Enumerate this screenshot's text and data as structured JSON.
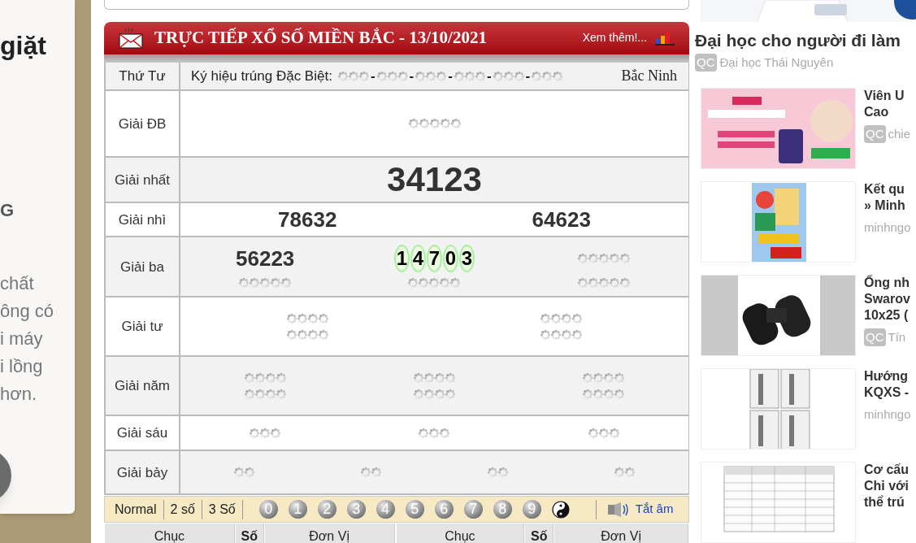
{
  "left_card": {
    "heading": "giặt",
    "subheading": "G",
    "paragraph_lines": [
      "chất",
      "ông có",
      "i máy",
      "i lồng",
      "hơn."
    ]
  },
  "results": {
    "title": "TRỰC TIẾP XỔ SỐ MIỀN BẮC - 13/10/2021",
    "more_link": "Xem thêm!...",
    "day": "Thứ Tư",
    "code_label": "Ký hiệu trúng Đặc Biệt:",
    "code_separator": "-",
    "code_groups": [
      {
        "kind": "pending",
        "digits": [
          {
            "kind": "loading"
          },
          {
            "kind": "loading"
          },
          {
            "kind": "loading"
          }
        ]
      },
      {
        "kind": "pending",
        "digits": [
          {
            "kind": "loading"
          },
          {
            "kind": "loading"
          },
          {
            "kind": "loading"
          }
        ]
      },
      {
        "kind": "pending",
        "digits": [
          {
            "kind": "loading"
          },
          {
            "kind": "loading"
          },
          {
            "kind": "loading"
          }
        ]
      },
      {
        "kind": "pending",
        "digits": [
          {
            "kind": "loading"
          },
          {
            "kind": "loading"
          },
          {
            "kind": "loading"
          }
        ]
      },
      {
        "kind": "pending",
        "digits": [
          {
            "kind": "loading"
          },
          {
            "kind": "loading"
          },
          {
            "kind": "loading"
          }
        ]
      },
      {
        "kind": "pending",
        "digits": [
          {
            "kind": "loading"
          },
          {
            "kind": "loading"
          },
          {
            "kind": "loading"
          }
        ]
      }
    ],
    "province": "Bắc Ninh",
    "prizes": [
      {
        "name": "Giải ĐB",
        "lines": [
          [
            {
              "kind": "pending",
              "digits": [
                {
                  "kind": "loading"
                },
                {
                  "kind": "loading"
                },
                {
                  "kind": "loading"
                },
                {
                  "kind": "loading"
                },
                {
                  "kind": "loading"
                }
              ]
            }
          ]
        ]
      },
      {
        "name": "Giải nhất",
        "lines": [
          [
            {
              "kind": "large",
              "value": "34123"
            }
          ]
        ]
      },
      {
        "name": "Giải nhì",
        "lines": [
          [
            {
              "kind": "number",
              "value": "78632"
            },
            {
              "kind": "number",
              "value": "64623"
            }
          ]
        ]
      },
      {
        "name": "Giải ba",
        "lines": [
          [
            {
              "kind": "number",
              "value": "56223"
            },
            {
              "kind": "rolling",
              "value": "14703"
            },
            {
              "kind": "pending",
              "digits": [
                {
                  "kind": "loading"
                },
                {
                  "kind": "loading"
                },
                {
                  "kind": "loading"
                },
                {
                  "kind": "loading"
                },
                {
                  "kind": "loading"
                }
              ]
            }
          ],
          [
            {
              "kind": "pending",
              "digits": [
                {
                  "kind": "loading"
                },
                {
                  "kind": "loading"
                },
                {
                  "kind": "loading"
                },
                {
                  "kind": "loading"
                },
                {
                  "kind": "loading"
                }
              ]
            },
            {
              "kind": "pending",
              "digits": [
                {
                  "kind": "loading"
                },
                {
                  "kind": "loading"
                },
                {
                  "kind": "loading"
                },
                {
                  "kind": "loading"
                },
                {
                  "kind": "loading"
                }
              ]
            },
            {
              "kind": "pending",
              "digits": [
                {
                  "kind": "loading"
                },
                {
                  "kind": "loading"
                },
                {
                  "kind": "loading"
                },
                {
                  "kind": "loading"
                },
                {
                  "kind": "loading"
                }
              ]
            }
          ]
        ]
      },
      {
        "name": "Giải tư",
        "lines": [
          [
            {
              "kind": "pending",
              "digits": [
                {
                  "kind": "loading"
                },
                {
                  "kind": "loading"
                },
                {
                  "kind": "loading"
                },
                {
                  "kind": "loading"
                }
              ]
            },
            {
              "kind": "pending",
              "digits": [
                {
                  "kind": "loading"
                },
                {
                  "kind": "loading"
                },
                {
                  "kind": "loading"
                },
                {
                  "kind": "loading"
                }
              ]
            }
          ],
          [
            {
              "kind": "pending",
              "digits": [
                {
                  "kind": "loading"
                },
                {
                  "kind": "loading"
                },
                {
                  "kind": "loading"
                },
                {
                  "kind": "loading"
                }
              ]
            },
            {
              "kind": "pending",
              "digits": [
                {
                  "kind": "loading"
                },
                {
                  "kind": "loading"
                },
                {
                  "kind": "loading"
                },
                {
                  "kind": "loading"
                }
              ]
            }
          ]
        ]
      },
      {
        "name": "Giải năm",
        "lines": [
          [
            {
              "kind": "pending",
              "digits": [
                {
                  "kind": "loading"
                },
                {
                  "kind": "loading"
                },
                {
                  "kind": "loading"
                },
                {
                  "kind": "loading"
                }
              ]
            },
            {
              "kind": "pending",
              "digits": [
                {
                  "kind": "loading"
                },
                {
                  "kind": "loading"
                },
                {
                  "kind": "loading"
                },
                {
                  "kind": "loading"
                }
              ]
            },
            {
              "kind": "pending",
              "digits": [
                {
                  "kind": "loading"
                },
                {
                  "kind": "loading"
                },
                {
                  "kind": "loading"
                },
                {
                  "kind": "loading"
                }
              ]
            }
          ],
          [
            {
              "kind": "pending",
              "digits": [
                {
                  "kind": "loading"
                },
                {
                  "kind": "loading"
                },
                {
                  "kind": "loading"
                },
                {
                  "kind": "loading"
                }
              ]
            },
            {
              "kind": "pending",
              "digits": [
                {
                  "kind": "loading"
                },
                {
                  "kind": "loading"
                },
                {
                  "kind": "loading"
                },
                {
                  "kind": "loading"
                }
              ]
            },
            {
              "kind": "pending",
              "digits": [
                {
                  "kind": "loading"
                },
                {
                  "kind": "loading"
                },
                {
                  "kind": "loading"
                },
                {
                  "kind": "loading"
                }
              ]
            }
          ]
        ]
      },
      {
        "name": "Giải sáu",
        "lines": [
          [
            {
              "kind": "pending",
              "digits": [
                {
                  "kind": "loading"
                },
                {
                  "kind": "loading"
                },
                {
                  "kind": "loading"
                }
              ]
            },
            {
              "kind": "pending",
              "digits": [
                {
                  "kind": "loading"
                },
                {
                  "kind": "loading"
                },
                {
                  "kind": "loading"
                }
              ]
            },
            {
              "kind": "pending",
              "digits": [
                {
                  "kind": "loading"
                },
                {
                  "kind": "loading"
                },
                {
                  "kind": "loading"
                }
              ]
            }
          ]
        ]
      },
      {
        "name": "Giải bảy",
        "lines": [
          [
            {
              "kind": "pending",
              "digits": [
                {
                  "kind": "loading"
                },
                {
                  "kind": "loading"
                }
              ]
            },
            {
              "kind": "pending",
              "digits": [
                {
                  "kind": "loading"
                },
                {
                  "kind": "loading"
                }
              ]
            },
            {
              "kind": "pending",
              "digits": [
                {
                  "kind": "loading"
                },
                {
                  "kind": "loading"
                }
              ]
            },
            {
              "kind": "pending",
              "digits": [
                {
                  "kind": "loading"
                },
                {
                  "kind": "loading"
                }
              ]
            }
          ]
        ]
      }
    ],
    "modes": [
      "Normal",
      "2 số",
      "3 Số"
    ],
    "digit_balls": [
      "0",
      "1",
      "2",
      "3",
      "4",
      "5",
      "6",
      "7",
      "8",
      "9"
    ],
    "mute_link": "Tắt âm",
    "columns": [
      "Chục",
      "Số",
      "Đơn Vị",
      "Chục",
      "Số",
      "Đơn Vị"
    ]
  },
  "ads": {
    "featured": {
      "kind": "picture",
      "title": "Đại học cho người đi làm",
      "badge": "QC",
      "source": "Đại học Thái Nguyên"
    },
    "items": [
      {
        "kind": "picture",
        "title_lines": [
          "Viên U",
          "Cao"
        ],
        "badge": "QC",
        "source": "chie"
      },
      {
        "kind": "picture",
        "title_lines": [
          "Kết qu",
          "» Minh"
        ],
        "source": "minhngo"
      },
      {
        "kind": "picture",
        "title_lines": [
          "Ống nh",
          "Swarov",
          "10x25 ("
        ],
        "badge": "QC",
        "source": "Tín"
      },
      {
        "kind": "picture",
        "title_lines": [
          "Hướng",
          "KQXS -"
        ],
        "source": "minhngo"
      },
      {
        "kind": "picture",
        "title_lines": [
          "Cơ cấu",
          "Chỉ với",
          "thể trú"
        ]
      }
    ]
  }
}
